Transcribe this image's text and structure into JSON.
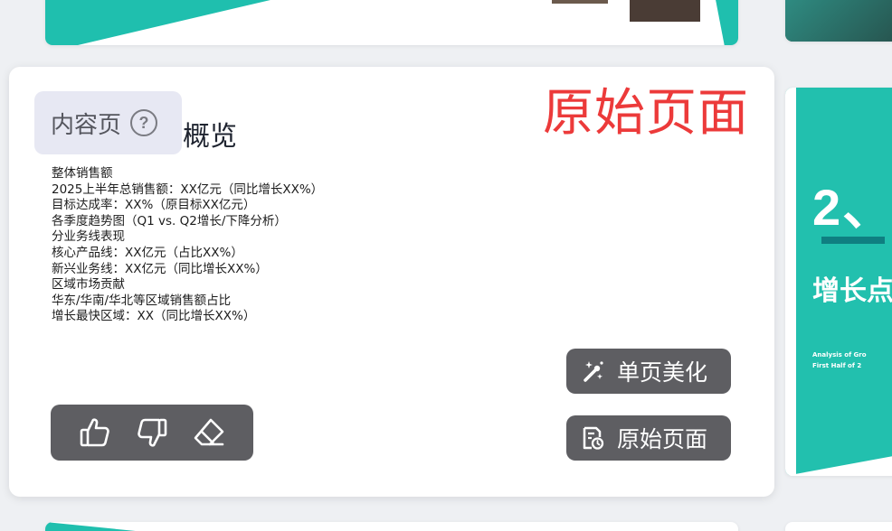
{
  "card": {
    "tag_label": "内容页",
    "help_icon": "question-circle-icon",
    "title_tail": "概览",
    "annotation": "原始页面",
    "content_lines": [
      "整体销售额",
      "2025上半年总销售额：XX亿元（同比增长XX%）",
      "目标达成率：XX%（原目标XX亿元）",
      "各季度趋势图（Q1 vs. Q2增长/下降分析）",
      "分业务线表现",
      "核心产品线：XX亿元（占比XX%）",
      "新兴业务线：XX亿元（同比增长XX%）",
      "区域市场贡献",
      "华东/华南/华北等区域销售额占比",
      "增长最快区域：XX（同比增长XX%）"
    ],
    "buttons": {
      "beautify_label": "单页美化",
      "beautify_icon": "magic-wand-icon",
      "original_label": "原始页面",
      "original_icon": "document-clock-icon"
    },
    "feedback": {
      "like_icon": "thumbs-up-icon",
      "dislike_icon": "thumbs-down-icon",
      "eraser_icon": "eraser-icon"
    }
  },
  "right_thumbnail": {
    "number": "2、",
    "subtitle": "增长点",
    "english_lines": [
      "Analysis of Gro",
      "First Half of 2"
    ]
  },
  "colors": {
    "accent_teal": "#1fbfae",
    "annotation_red": "#ec3a3a",
    "pill_gray": "#5e5e62",
    "tag_bg": "#e7e8f3"
  }
}
